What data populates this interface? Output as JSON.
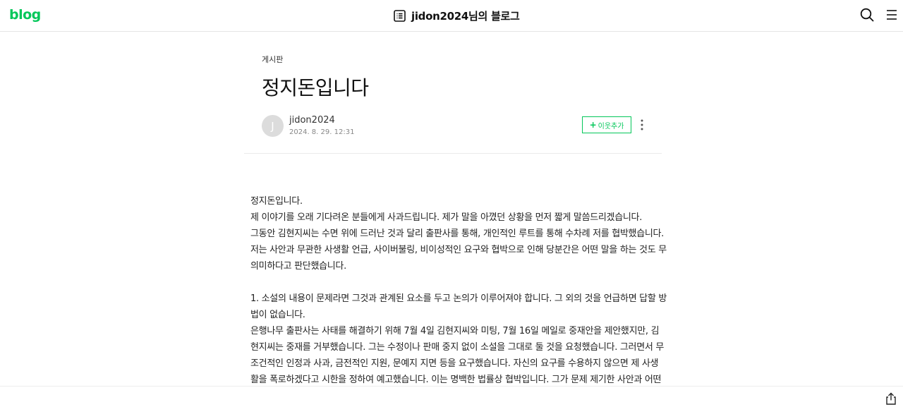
{
  "header": {
    "logo": "blog",
    "blog_title": "jidon2024님의 블로그"
  },
  "post": {
    "category": "게시판",
    "title": "정지돈입니다",
    "author": "jidon2024",
    "avatar_letter": "J",
    "date": "2024. 8. 29. 12:31",
    "follow_label": "이웃추가",
    "follow_plus": "+"
  },
  "content": {
    "lines": [
      "정지돈입니다.",
      "제 이야기를 오래 기다려온 분들에게 사과드립니다. 제가 말을 아꼈던 상황을 먼저 짧게 말씀드리겠습니다.",
      "그동안 김현지씨는 수면 위에 드러난 것과 달리 출판사를 통해, 개인적인 루트를 통해 수차례 저를 협박했습니다.",
      "저는 사안과 무관한 사생활 언급, 사이버불링, 비이성적인 요구와 협박으로 인해 당분간은 어떤 말을 하는 것도 무",
      "의미하다고 판단했습니다.",
      "",
      "1. 소설의 내용이 문제라면 그것과 관계된 요소를 두고 논의가 이루어져야 합니다. 그 외의 것을 언급하면 답할 방",
      "법이 없습니다.",
      "은행나무 출판사는 사태를 해결하기 위해 7월 4일 김현지씨와 미팅, 7월 16일 메일로 중재안을 제안했지만, 김",
      "현지씨는 중재를 거부했습니다. 그는 수정이나 판매 중지 없이 소설을 그대로 둘 것을 요청했습니다. 그러면서 무",
      "조건적인 인정과 사과, 금전적인 지원, 문예지 지면 등을 요구했습니다. 자신의 요구를 수용하지 않으면 제 사생",
      "활을 폭로하겠다고 시한을 정하여 예고했습니다. 이는 명백한 법률상 협박입니다. 그가 문제 제기한 사안과 어떤"
    ]
  },
  "colors": {
    "brand": "#03c75a",
    "text": "#222222",
    "muted": "#888888"
  },
  "icons": [
    "list-icon",
    "search-icon",
    "menu-icon",
    "more-icon",
    "share-icon"
  ]
}
